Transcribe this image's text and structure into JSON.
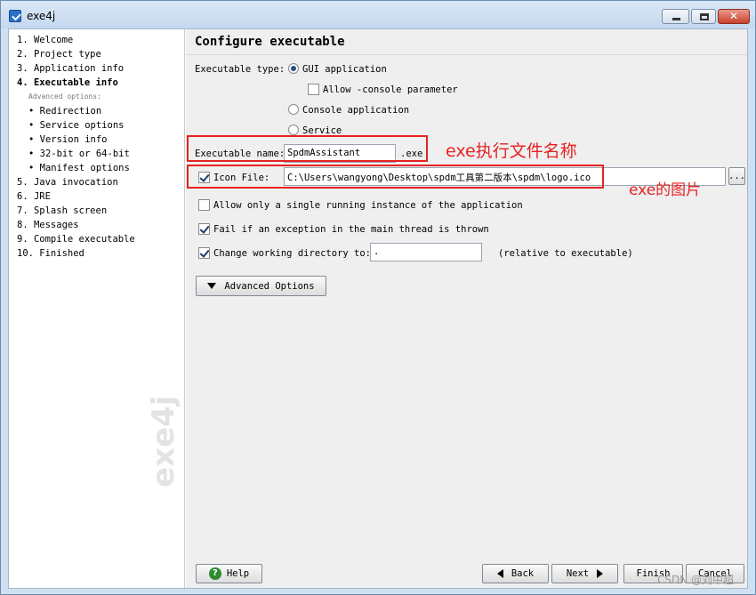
{
  "window": {
    "title": "exe4j"
  },
  "sidebar": {
    "steps": [
      "1. Welcome",
      "2. Project type",
      "3. Application info",
      "4. Executable info",
      "5. Java invocation",
      "6. JRE",
      "7. Splash screen",
      "8. Messages",
      "9. Compile executable",
      "10. Finished"
    ],
    "advanced_label": "Advanced options:",
    "substeps": [
      "• Redirection",
      "• Service options",
      "• Version info",
      "• 32-bit or 64-bit",
      "• Manifest options"
    ],
    "watermark": "exe4j"
  },
  "main": {
    "title": "Configure executable",
    "executable_type_label": "Executable type:",
    "type_options": [
      "GUI application",
      "Console application",
      "Service"
    ],
    "selected_type": "GUI application",
    "allow_console_label": "Allow -console parameter",
    "executable_name_label": "Executable name:",
    "executable_name_value": "SpdmAssistant",
    "exe_suffix": ".exe",
    "icon_file_label": "Icon File:",
    "icon_file_value": "C:\\Users\\wangyong\\Desktop\\spdm工具第二版本\\spdm\\logo.ico",
    "browse_label": "...",
    "single_instance_label": "Allow only a single running instance of the application",
    "fail_exception_label": "Fail if an exception in the main thread is thrown",
    "change_dir_label": "Change working directory to:",
    "change_dir_value": ".",
    "relative_label": "(relative to executable)",
    "advanced_button": "Advanced Options"
  },
  "buttons": {
    "help": "Help",
    "back": "Back",
    "next": "Next",
    "finish": "Finish",
    "cancel": "Cancel"
  },
  "annotations": {
    "name_note": "exe执行文件名称",
    "icon_note": "exe的图片",
    "color": "#e62222"
  },
  "watermark_text": "CSDN @刘中超"
}
